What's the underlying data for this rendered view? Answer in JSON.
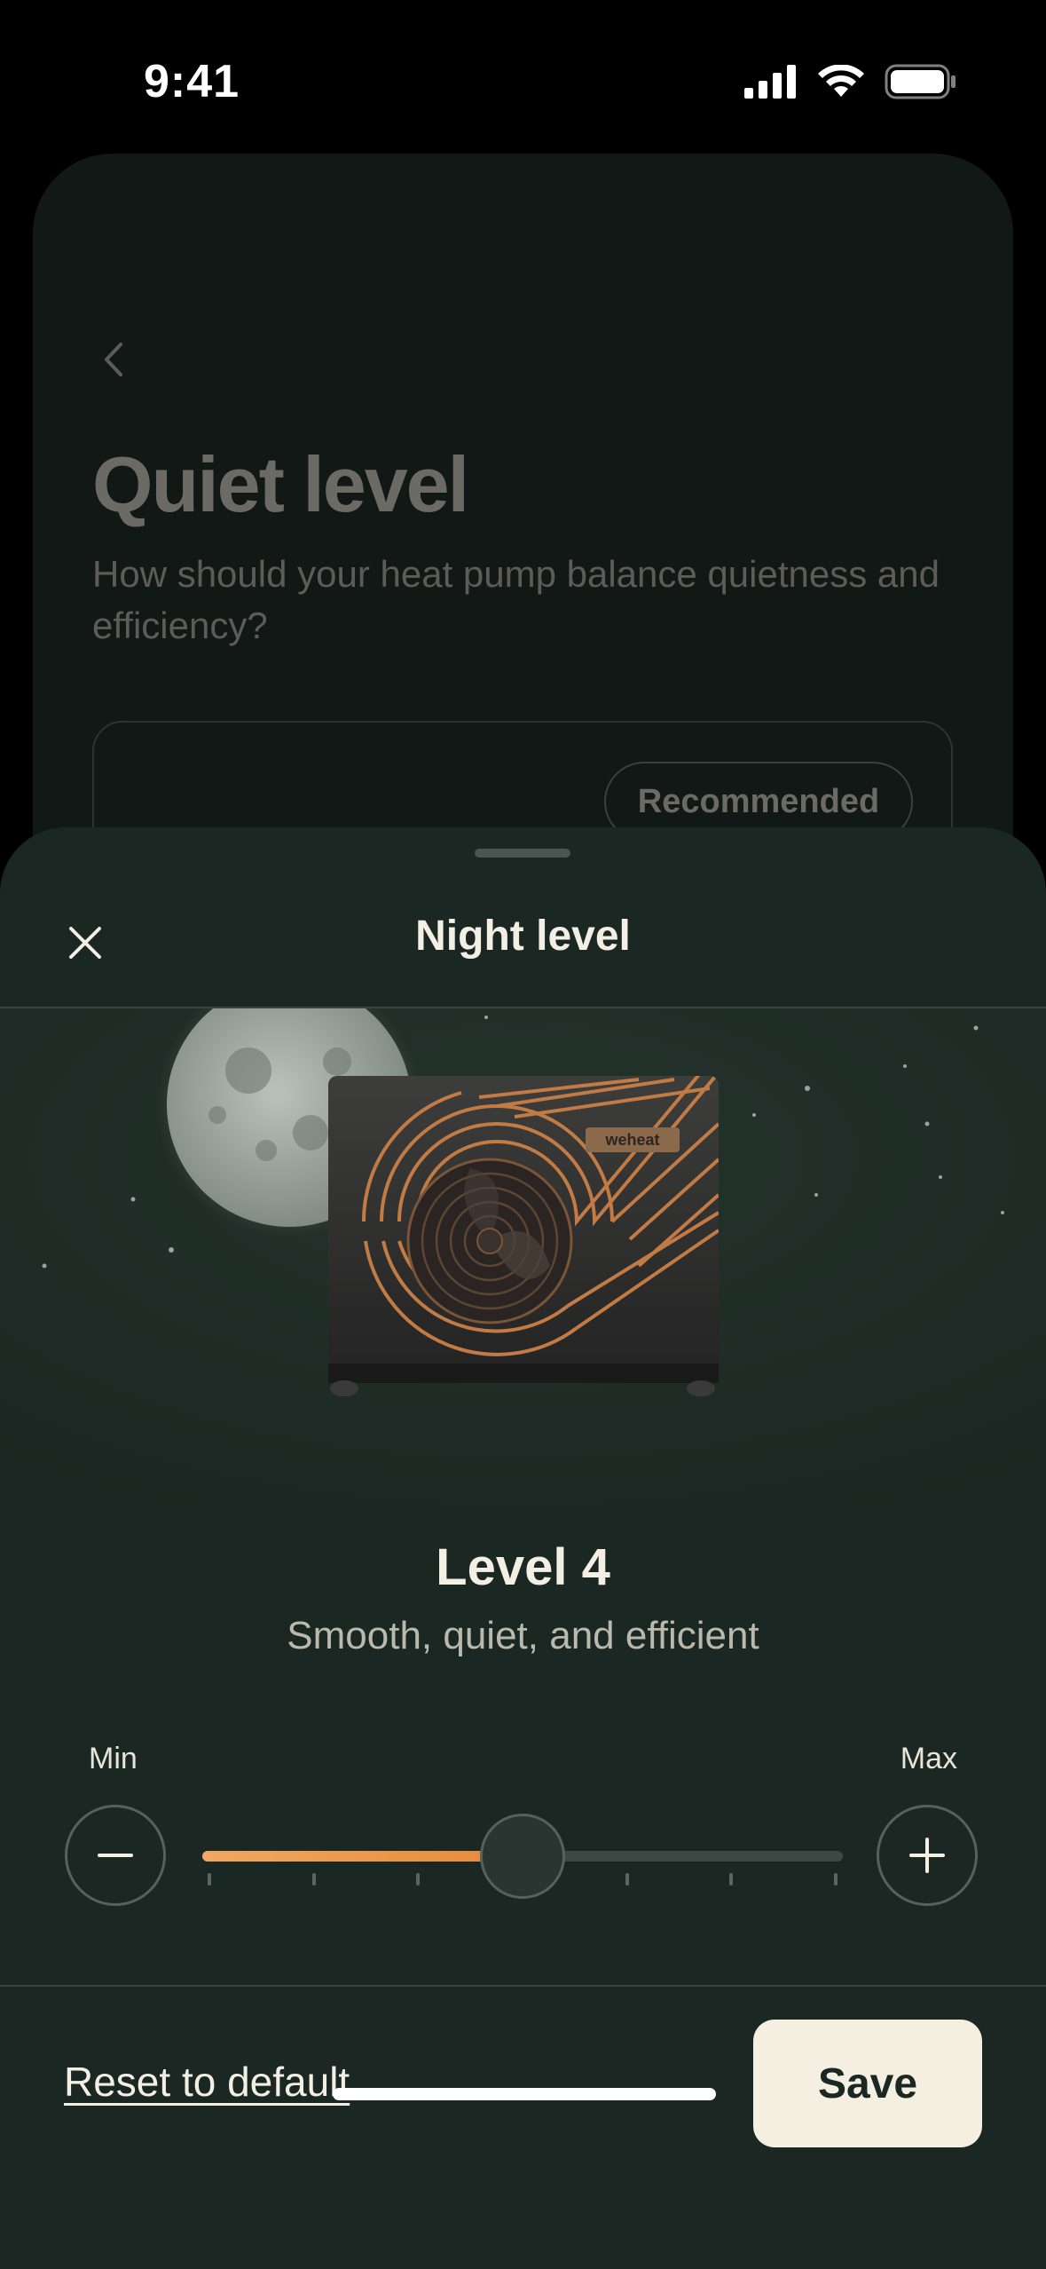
{
  "status_bar": {
    "time": "9:41"
  },
  "background_screen": {
    "title": "Quiet level",
    "subtitle": "How should your heat pump balance quietness and efficiency?",
    "badge": "Recommended"
  },
  "sheet": {
    "title": "Night level",
    "hero": {
      "brand_text": "weheat"
    },
    "level": {
      "title": "Level 4",
      "description": "Smooth, quiet, and efficient"
    },
    "slider": {
      "min_label": "Min",
      "max_label": "Max",
      "value": 4,
      "min": 1,
      "max": 7,
      "fill_color": "#e58a3a"
    },
    "footer": {
      "reset_label": "Reset to default",
      "save_label": "Save"
    }
  }
}
